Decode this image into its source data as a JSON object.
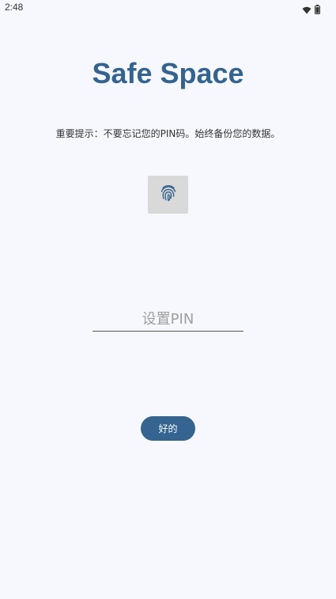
{
  "status_bar": {
    "time": "2:48",
    "icons": [
      "wifi-icon",
      "battery-icon"
    ]
  },
  "app": {
    "title": "Safe Space",
    "notice": "重要提示：不要忘记您的PIN码。始终备份您的数据。"
  },
  "fingerprint": {
    "icon": "fingerprint-icon"
  },
  "pin_input": {
    "placeholder": "设置PIN",
    "value": ""
  },
  "ok_button": {
    "label": "好的"
  },
  "colors": {
    "background": "#f7f8fd",
    "accent": "#34648f",
    "fingerprint_bg": "#d9d9d9"
  }
}
